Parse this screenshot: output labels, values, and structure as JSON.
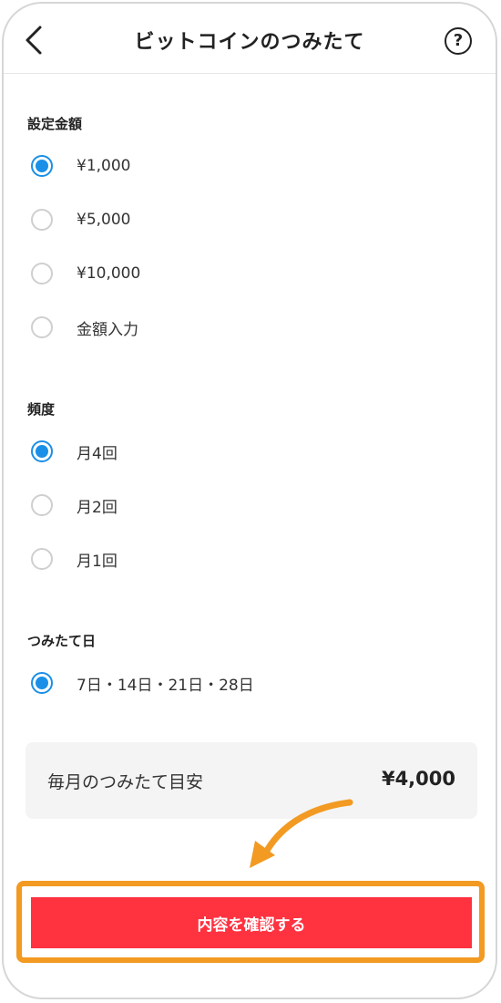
{
  "header": {
    "title": "ビットコインのつみたて",
    "back_icon": "chevron-left-icon",
    "help_icon": "help-icon",
    "help_glyph": "?"
  },
  "amount": {
    "title": "設定金額",
    "options": [
      "¥1,000",
      "¥5,000",
      "¥10,000",
      "金額入力"
    ],
    "selected": "¥1,000"
  },
  "frequency": {
    "title": "頻度",
    "options": [
      "月4回",
      "月2回",
      "月1回"
    ],
    "selected": "月4回"
  },
  "day": {
    "title": "つみたて日",
    "options": [
      "7日・14日・21日・28日"
    ],
    "selected": "7日・14日・21日・28日"
  },
  "estimate": {
    "label": "毎月のつみたて目安",
    "value": "¥4,000"
  },
  "confirm": {
    "label": "内容を確認する"
  },
  "colors": {
    "accent": "#1a8fe8",
    "button": "#ff3240",
    "highlight": "#f29a22"
  }
}
